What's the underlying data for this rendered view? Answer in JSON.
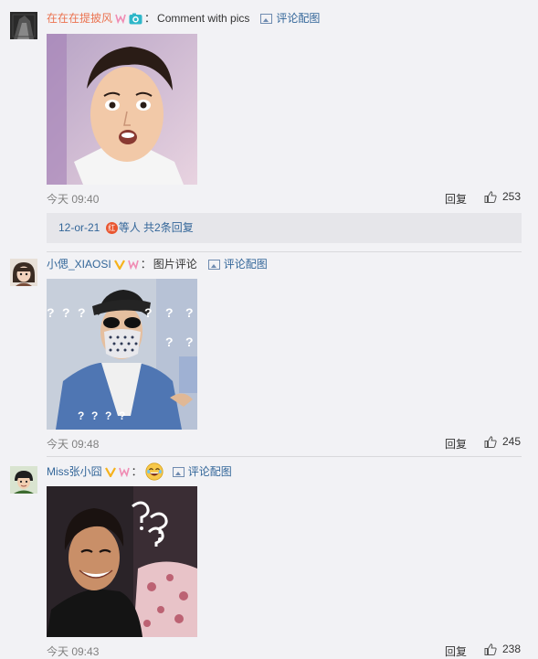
{
  "comments": [
    {
      "username": "在在在提披风",
      "username_color": "#eb7350",
      "badges": [
        "w-badge",
        "camera-badge"
      ],
      "text": "Comment with pics",
      "pic_link": "评论配图",
      "time": "今天 09:40",
      "reply_label": "回复",
      "likes": "253",
      "sub_reply": {
        "user": "12-or-21",
        "rest": "等人 共2条回复",
        "badge_text": "红"
      }
    },
    {
      "username": "小偲_XIAOSI",
      "username_color": "#336699",
      "badges": [
        "v-badge",
        "w-badge"
      ],
      "text": "图片评论",
      "pic_link": "评论配图",
      "time": "今天 09:48",
      "reply_label": "回复",
      "likes": "245",
      "question_marks": [
        "?",
        "?",
        "?",
        "?",
        "?",
        "?",
        "?",
        "?",
        "?",
        "?",
        "?",
        "?"
      ]
    },
    {
      "username": "Miss张小囧",
      "username_color": "#336699",
      "badges": [
        "v-badge",
        "w-badge",
        "laughing-emoji"
      ],
      "text": "",
      "pic_link": "评论配图",
      "time": "今天 09:43",
      "reply_label": "回复",
      "likes": "238",
      "overlay_text": "???"
    }
  ],
  "colors": {
    "link_blue": "#336699",
    "name_orange": "#eb7350",
    "time_gray": "#808080",
    "badge_pink": "#f08cb4",
    "badge_gold": "#f6b21b"
  }
}
